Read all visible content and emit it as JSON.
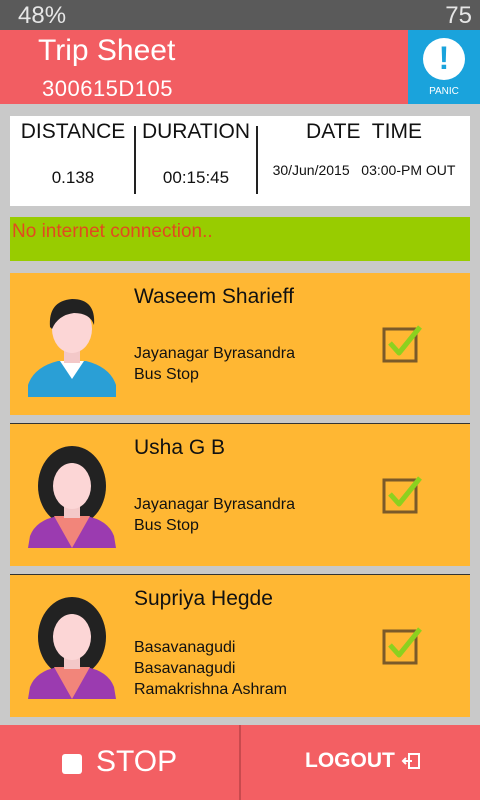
{
  "status_bar": {
    "battery_left": "48%",
    "battery_right": "75"
  },
  "header": {
    "title": "Trip Sheet",
    "trip_id": "300615D105",
    "panic_label": "PANIC"
  },
  "trip_info": {
    "distance_label": "DISTANCE",
    "distance_value": "0.138",
    "duration_label": "DURATION",
    "duration_value": "00:15:45",
    "datetime_label": "DATE  TIME",
    "datetime_value": "30/Jun/2015   03:00-PM OUT"
  },
  "warning": {
    "text": "No internet connection.."
  },
  "passengers": [
    {
      "name": "Waseem Sharieff",
      "address_lines": [
        "Jayanagar Byrasandra",
        "Bus Stop"
      ],
      "checked": true,
      "avatar": "male-avatar"
    },
    {
      "name": "Usha G B",
      "address_lines": [
        "Jayanagar Byrasandra",
        "Bus Stop"
      ],
      "checked": true,
      "avatar": "female-avatar"
    },
    {
      "name": "Supriya Hegde",
      "address_lines": [
        "Basavanagudi",
        "Basavanagudi",
        "Ramakrishna Ashram"
      ],
      "checked": true,
      "avatar": "female-avatar"
    }
  ],
  "footer": {
    "stop_label": "STOP",
    "logout_label": "LOGOUT"
  },
  "colors": {
    "header": "#f25d62",
    "panic": "#1aa3dc",
    "card": "#ffb733",
    "warning_bg": "#98cc00",
    "warning_text": "#e24a1f",
    "check": "#8cd11f"
  }
}
